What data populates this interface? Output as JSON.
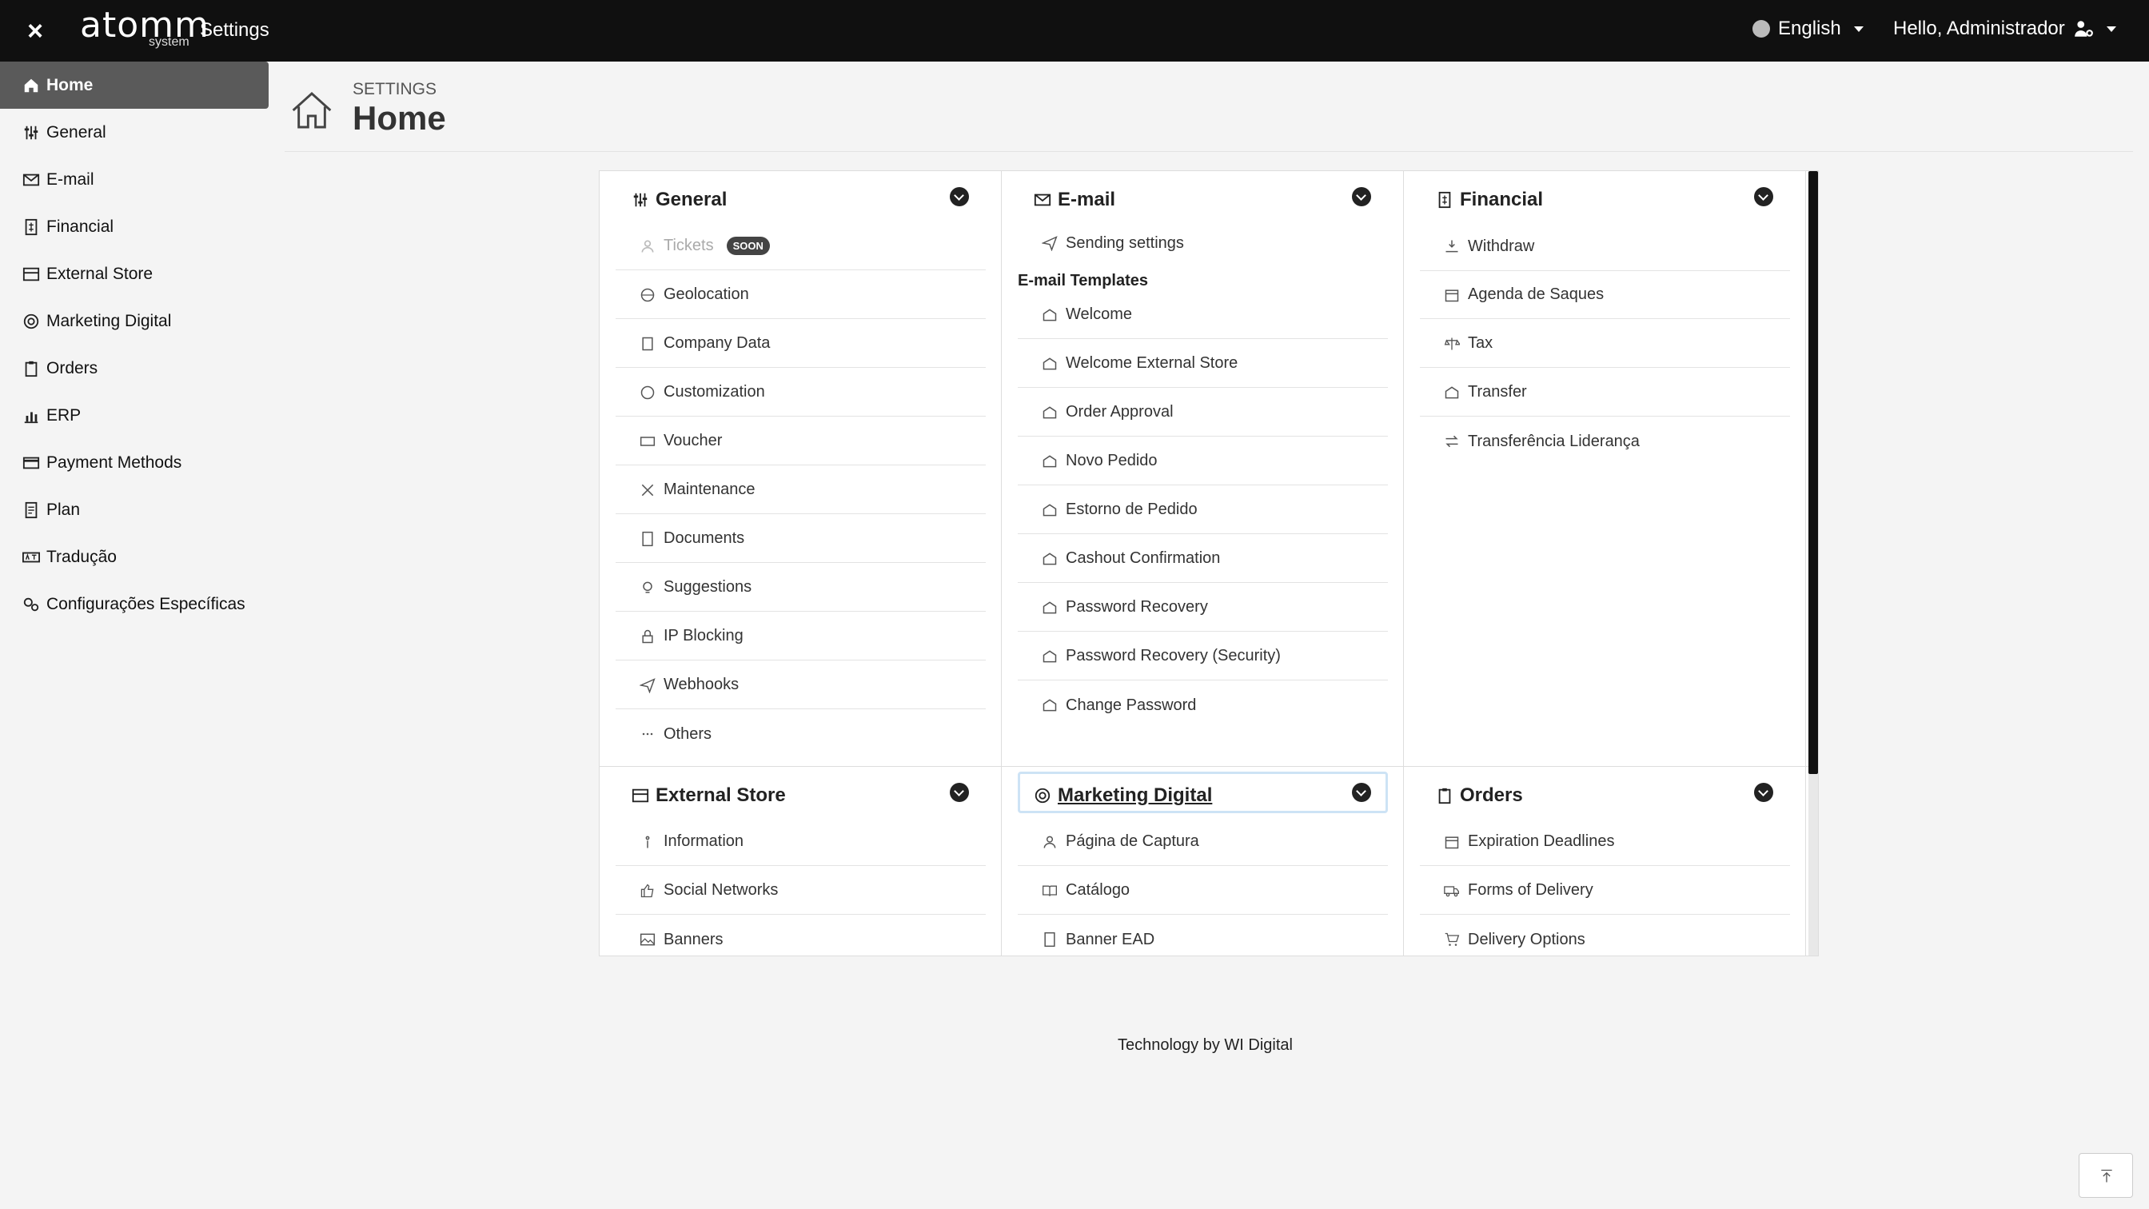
{
  "topbar": {
    "close_label": "×",
    "logo": "atomm",
    "logo_sub": "system",
    "app_title": "Settings",
    "language": "English",
    "user_greeting": "Hello, Administrador"
  },
  "sidebar": {
    "items": [
      {
        "label": "Home",
        "icon": "home-icon"
      },
      {
        "label": "General",
        "icon": "sliders-icon"
      },
      {
        "label": "E-mail",
        "icon": "envelope-icon"
      },
      {
        "label": "Financial",
        "icon": "dollar-doc-icon"
      },
      {
        "label": "External Store",
        "icon": "store-icon"
      },
      {
        "label": "Marketing Digital",
        "icon": "megaphone-icon"
      },
      {
        "label": "Orders",
        "icon": "clipboard-icon"
      },
      {
        "label": "ERP",
        "icon": "chart-icon"
      },
      {
        "label": "Payment Methods",
        "icon": "card-icon"
      },
      {
        "label": "Plan",
        "icon": "doc-icon"
      },
      {
        "label": "Tradução",
        "icon": "translate-icon"
      },
      {
        "label": "Configurações Específicas",
        "icon": "gears-icon"
      }
    ]
  },
  "header": {
    "crumb": "SETTINGS",
    "title": "Home"
  },
  "columns": {
    "general": {
      "title": "General",
      "tickets": "Tickets",
      "soon": "SOON",
      "items": [
        "Geolocation",
        "Company Data",
        "Customization",
        "Voucher",
        "Maintenance",
        "Documents",
        "Suggestions",
        "IP Blocking",
        "Webhooks",
        "Others"
      ]
    },
    "email": {
      "title": "E-mail",
      "sending": "Sending settings",
      "templates_title": "E-mail Templates",
      "templates": [
        "Welcome",
        "Welcome External Store",
        "Order Approval",
        "Novo Pedido",
        "Estorno de Pedido",
        "Cashout Confirmation",
        "Password Recovery",
        "Password Recovery (Security)",
        "Change Password"
      ]
    },
    "financial": {
      "title": "Financial",
      "items": [
        "Withdraw",
        "Agenda de Saques",
        "Tax",
        "Transfer",
        "Transferência Liderança"
      ]
    },
    "external_store": {
      "title": "External Store",
      "items": [
        "Information",
        "Social Networks",
        "Banners"
      ]
    },
    "marketing": {
      "title": "Marketing Digital",
      "items": [
        "Página de Captura",
        "Catálogo",
        "Banner EAD"
      ]
    },
    "orders": {
      "title": "Orders",
      "items": [
        "Expiration Deadlines",
        "Forms of Delivery",
        "Delivery Options"
      ]
    }
  },
  "footer": {
    "text": "Technology by WI Digital"
  }
}
